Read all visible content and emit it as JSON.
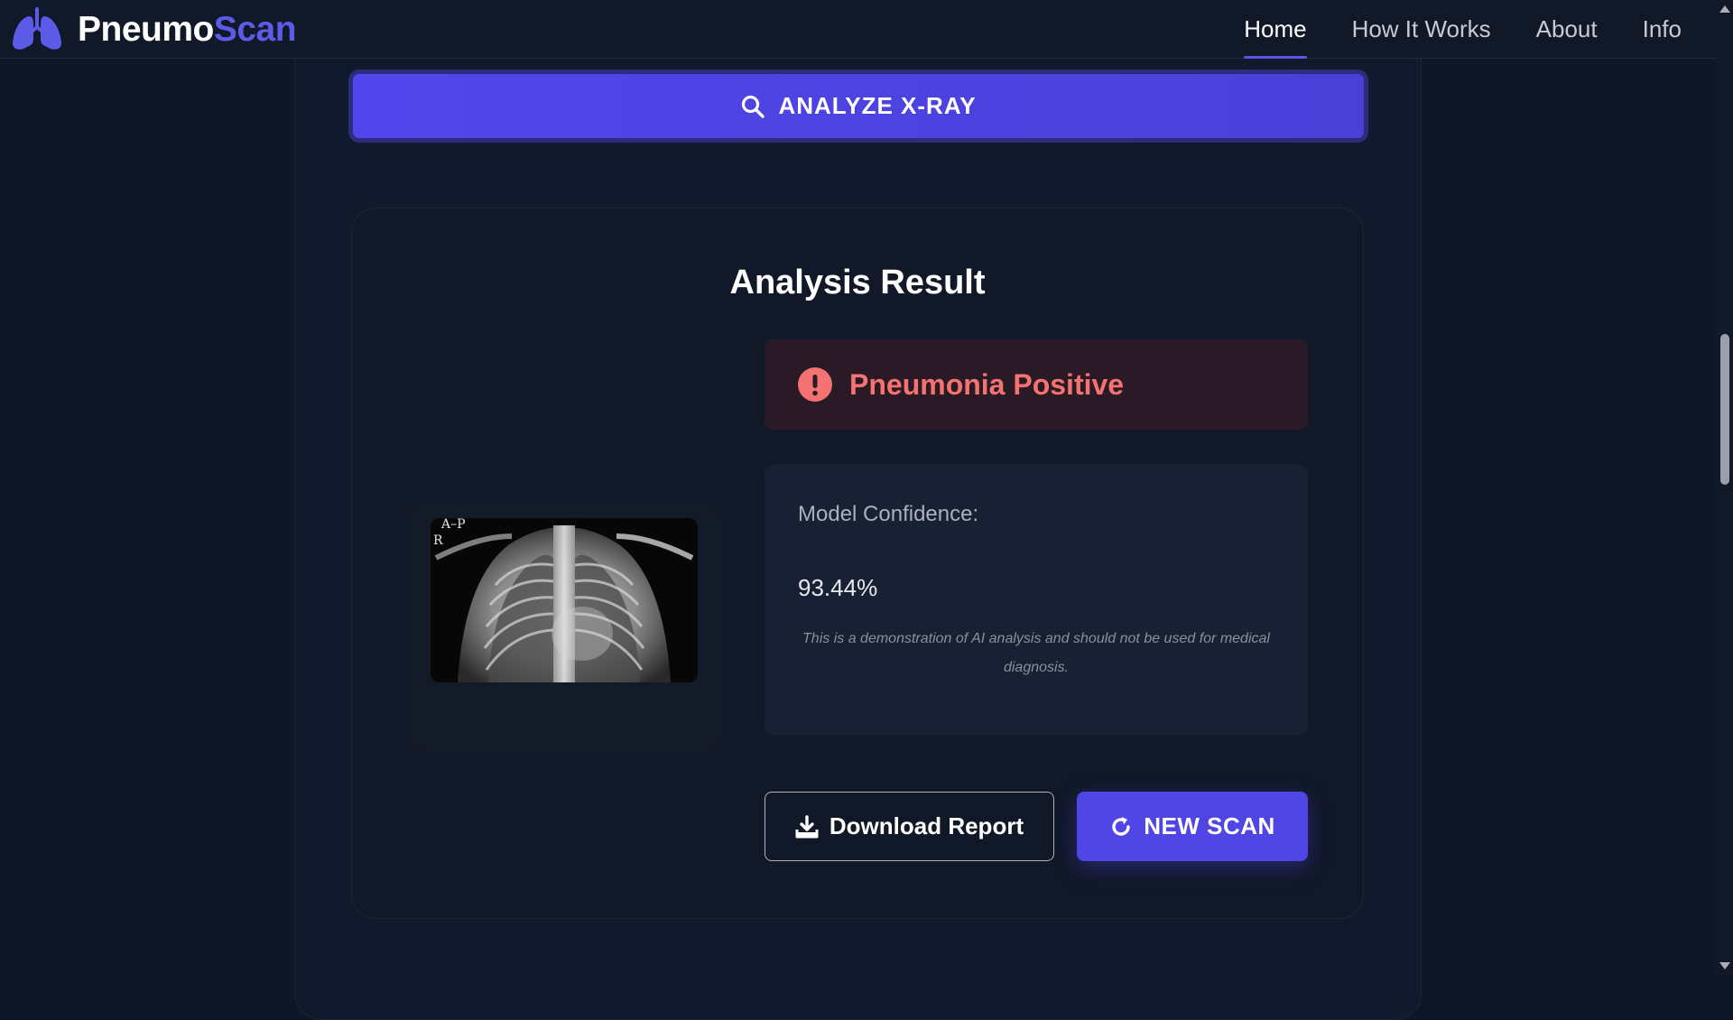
{
  "brand": {
    "name_part1": "Pneumo",
    "name_part2": "Scan",
    "logo_icon": "lungs-icon",
    "accent_color": "#5b5be8"
  },
  "nav": {
    "items": [
      {
        "label": "Home",
        "active": true
      },
      {
        "label": "How It Works",
        "active": false
      },
      {
        "label": "About",
        "active": false
      },
      {
        "label": "Info",
        "active": false
      }
    ]
  },
  "actions": {
    "analyze_label": "ANALYZE X-RAY",
    "analyze_icon": "search-icon"
  },
  "result": {
    "title": "Analysis Result",
    "xray_labels": {
      "view": "A–P",
      "side": "R"
    },
    "diagnosis": "Pneumonia Positive",
    "diagnosis_icon": "alert-circle-icon",
    "diagnosis_color": "#f47272",
    "confidence_label": "Model Confidence:",
    "confidence_value": "93.44%",
    "disclaimer": "This is a demonstration of AI analysis and should not be used for medical diagnosis.",
    "download_label": "Download Report",
    "download_icon": "download-icon",
    "new_scan_label": "NEW SCAN",
    "new_scan_icon": "refresh-icon"
  },
  "colors": {
    "background": "#0f1628",
    "primary": "#4f46e5",
    "panel": "#182033"
  }
}
